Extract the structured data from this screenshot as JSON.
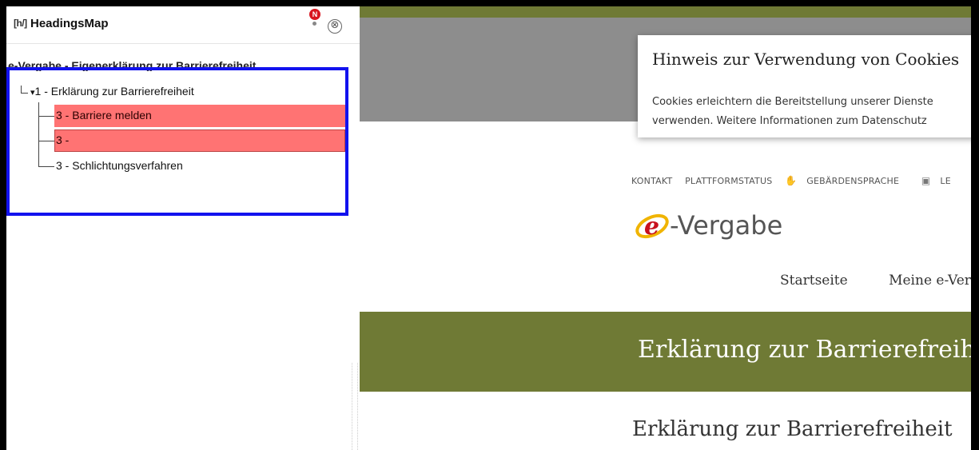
{
  "sidebar": {
    "logo_label": "[h/]",
    "title": "HeadingsMap",
    "notification_badge": "N",
    "close_label": "⊗",
    "document_title": "e-Vergabe - Eigenerklärung zur Barrierefreiheit",
    "tree": [
      {
        "label": "1 -  Erklärung zur Barrierefreiheit",
        "level": 1,
        "error": false
      },
      {
        "label": "3 - Barriere melden",
        "level": 3,
        "error": true
      },
      {
        "label": "3 -",
        "level": 3,
        "error": true
      },
      {
        "label": "3 - Schlichtungsverfahren",
        "level": 3,
        "error": false
      }
    ],
    "expander": "▾",
    "highlight_color": "#1212ee",
    "error_color": "#ff7373"
  },
  "page": {
    "cookie": {
      "title": "Hinweis zur Verwendung von Cookies",
      "text_line1": "Cookies erleichtern die Bereitstellung unserer Dienste",
      "text_line2": "verwenden. Weitere Informationen zum Datenschutz"
    },
    "util_nav": {
      "kontakt": "KONTAKT",
      "plattformstatus": "PLATTFORMSTATUS",
      "gebaerdensprache": "GEBÄRDENSPRACHE",
      "leichte_sprache": "LE"
    },
    "logo_text": "-Vergabe",
    "main_nav": {
      "startseite": "Startseite",
      "meine": "Meine e-Ver"
    },
    "hero_title": "Erklärung zur Barrierefreiheit",
    "content_title": "Erklärung zur Barrierefreiheit",
    "brand_color": "#6f7a35"
  }
}
